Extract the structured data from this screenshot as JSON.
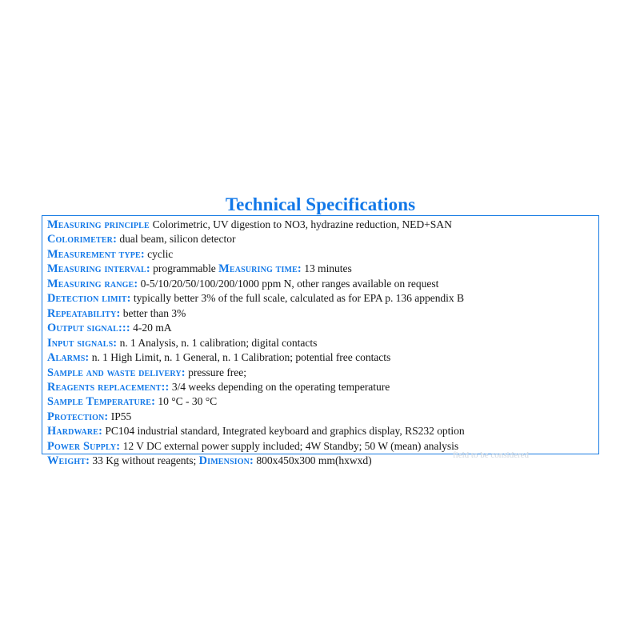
{
  "document": {
    "title": "Technical Specifications",
    "accent_color": "#1278e8",
    "border_color": "#1a7de4",
    "background_color": "#ffffff",
    "text_color": "#171717"
  },
  "specs": [
    {
      "label": "Measuring principle",
      "separator": " ",
      "value": "Colorimetric, UV digestion to NO3, hydrazine reduction, NED+SAN"
    },
    {
      "label": "Colorimeter",
      "separator": ":",
      "value": " dual beam, silicon detector"
    },
    {
      "label": "Measurement type",
      "separator": ":",
      "value": " cyclic"
    },
    {
      "label": "Measuring interval",
      "separator": ":",
      "value": " programmable  ",
      "label2": "Measuring time",
      "separator2": ":",
      "value2": " 13 minutes"
    },
    {
      "label": "Measuring range",
      "separator": ":",
      "value": " 0-5/10/20/50/100/200/1000 ppm N, other ranges available on request"
    },
    {
      "label": "Detection limit",
      "separator": ":",
      "value": " typically better  3% of the full scale, calculated as for EPA p. 136 appendix B"
    },
    {
      "label": "Repeatability",
      "separator": ":",
      "value": "  better than 3%"
    },
    {
      "label": "Output signal",
      "separator": ":::",
      "value": " 4-20 mA"
    },
    {
      "label": "Input signals",
      "separator": ":",
      "value": " n. 1 Analysis, n. 1 calibration;  digital contacts"
    },
    {
      "label": "Alarms",
      "separator": ":",
      "value": " n. 1 High Limit, n. 1 General,  n. 1 Calibration;  potential free contacts"
    },
    {
      "label": "Sample and waste delivery",
      "separator": ":",
      "value": " pressure free;"
    },
    {
      "label": "Reagents replacement",
      "separator": "::",
      "value": " 3/4 weeks depending on the operating temperature"
    },
    {
      "label": "Sample Temperature",
      "separator": ":",
      "value": " 10 °C - 30 °C"
    },
    {
      "label": "Protection",
      "separator": ":",
      "value": " IP55"
    },
    {
      "label": "Hardware",
      "separator": ":",
      "value": " PC104 industrial standard, Integrated keyboard and graphics display, RS232 option"
    },
    {
      "label": "Power Supply",
      "separator": ":",
      "value": " 12 V DC external power supply included; 4W Standby; 50 W (mean) analysis"
    },
    {
      "label": "Weight",
      "separator": ":",
      "value": " 33 Kg without reagents; ",
      "label2": "Dimension",
      "separator2": ":",
      "value2": " 800x450x300 mm(hxwxd)"
    }
  ],
  "footer": {
    "remnant_text": "field to be considered"
  }
}
